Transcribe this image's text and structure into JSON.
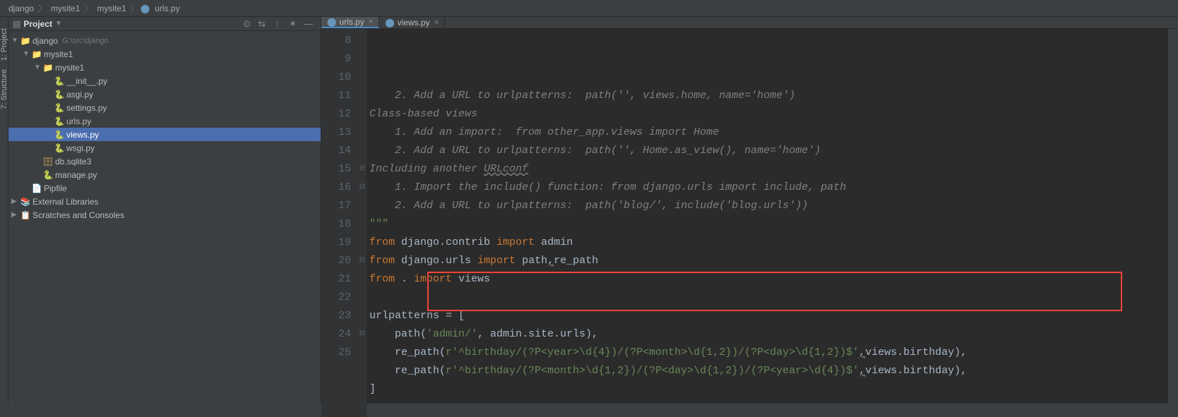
{
  "breadcrumbs": [
    "django",
    "mysite1",
    "mysite1",
    "urls.py"
  ],
  "sidebar": {
    "title": "Project",
    "tree": [
      {
        "d": 0,
        "tw": "open",
        "icon": "dir",
        "label": "django",
        "dim": "G:\\src\\django",
        "sel": ""
      },
      {
        "d": 1,
        "tw": "open",
        "icon": "dir",
        "label": "mysite1",
        "sel": ""
      },
      {
        "d": 2,
        "tw": "open",
        "icon": "dir",
        "label": "mysite1",
        "sel": ""
      },
      {
        "d": 3,
        "tw": "",
        "icon": "py",
        "label": "__init__.py",
        "sel": ""
      },
      {
        "d": 3,
        "tw": "",
        "icon": "py",
        "label": "asgi.py",
        "sel": ""
      },
      {
        "d": 3,
        "tw": "",
        "icon": "py",
        "label": "settings.py",
        "sel": ""
      },
      {
        "d": 3,
        "tw": "",
        "icon": "py",
        "label": "urls.py",
        "sel": ""
      },
      {
        "d": 3,
        "tw": "",
        "icon": "py",
        "label": "views.py",
        "sel": "selected-hl"
      },
      {
        "d": 3,
        "tw": "",
        "icon": "py",
        "label": "wsgi.py",
        "sel": ""
      },
      {
        "d": 2,
        "tw": "",
        "icon": "db",
        "label": "db.sqlite3",
        "sel": ""
      },
      {
        "d": 2,
        "tw": "",
        "icon": "py",
        "label": "manage.py",
        "sel": ""
      },
      {
        "d": 1,
        "tw": "",
        "icon": "txt",
        "label": "Pipfile",
        "sel": ""
      },
      {
        "d": 0,
        "tw": "closed",
        "icon": "lib",
        "label": "External Libraries",
        "sel": ""
      },
      {
        "d": 0,
        "tw": "closed",
        "icon": "scratch",
        "label": "Scratches and Consoles",
        "sel": ""
      }
    ]
  },
  "leftTabs": [
    "1: Project",
    "7: Structure"
  ],
  "tabs": [
    {
      "label": "urls.py",
      "active": true
    },
    {
      "label": "views.py",
      "active": false
    }
  ],
  "lines": [
    {
      "n": 8,
      "segs": [
        {
          "t": "    2. Add a URL to urlpatterns:  path('', views.home, name='home')",
          "c": "c-comment"
        }
      ]
    },
    {
      "n": 9,
      "segs": [
        {
          "t": "Class-based views",
          "c": "c-comment"
        }
      ]
    },
    {
      "n": 10,
      "segs": [
        {
          "t": "    1. Add an import:  from other_app.views import Home",
          "c": "c-comment"
        }
      ]
    },
    {
      "n": 11,
      "segs": [
        {
          "t": "    2. Add a URL to urlpatterns:  path('', Home.as_view(), name='home')",
          "c": "c-comment"
        }
      ]
    },
    {
      "n": 12,
      "segs": [
        {
          "t": "Including another ",
          "c": "c-comment"
        },
        {
          "t": "URLconf",
          "c": "c-comment c-wavy"
        }
      ]
    },
    {
      "n": 13,
      "segs": [
        {
          "t": "    1. Import the include() function: from django.urls import include, path",
          "c": "c-comment"
        }
      ]
    },
    {
      "n": 14,
      "segs": [
        {
          "t": "    2. Add a URL to urlpatterns:  path('blog/', include('blog.urls'))",
          "c": "c-comment"
        }
      ]
    },
    {
      "n": 15,
      "segs": [
        {
          "t": "\"\"\"",
          "c": "c-string"
        }
      ],
      "fold": "⊟"
    },
    {
      "n": 16,
      "segs": [
        {
          "t": "from ",
          "c": "c-keyword"
        },
        {
          "t": "django.contrib ",
          "c": "c-ident"
        },
        {
          "t": "import ",
          "c": "c-keyword"
        },
        {
          "t": "admin",
          "c": "c-ident"
        }
      ],
      "fold": "⊟"
    },
    {
      "n": 17,
      "segs": [
        {
          "t": "from ",
          "c": "c-keyword"
        },
        {
          "t": "django.urls ",
          "c": "c-ident"
        },
        {
          "t": "import ",
          "c": "c-keyword"
        },
        {
          "t": "path",
          "c": "c-ident"
        },
        {
          "t": ",",
          "c": "c-op c-wavy"
        },
        {
          "t": "re_path",
          "c": "c-ident"
        }
      ]
    },
    {
      "n": 18,
      "segs": [
        {
          "t": "from ",
          "c": "c-keyword"
        },
        {
          "t": ". ",
          "c": "c-ident"
        },
        {
          "t": "import ",
          "c": "c-keyword"
        },
        {
          "t": "views",
          "c": "c-ident"
        }
      ]
    },
    {
      "n": 19,
      "segs": [
        {
          "t": "",
          "c": ""
        }
      ]
    },
    {
      "n": 20,
      "segs": [
        {
          "t": "urlpatterns = [",
          "c": "c-ident"
        }
      ],
      "fold": "⊟"
    },
    {
      "n": 21,
      "segs": [
        {
          "t": "    path(",
          "c": "c-ident"
        },
        {
          "t": "'admin/'",
          "c": "c-string"
        },
        {
          "t": ", admin.site.urls),",
          "c": "c-ident"
        }
      ]
    },
    {
      "n": 22,
      "segs": [
        {
          "t": "    re_path(",
          "c": "c-ident"
        },
        {
          "t": "r'^birthday/(?P<year>\\d{4})/(?P<month>\\d{1,2})/(?P<day>\\d{1,2})$'",
          "c": "c-string"
        },
        {
          "t": ",",
          "c": "c-op c-wavy"
        },
        {
          "t": "views.birthday),",
          "c": "c-ident"
        }
      ]
    },
    {
      "n": 23,
      "segs": [
        {
          "t": "    re_path(",
          "c": "c-ident"
        },
        {
          "t": "r'^birthday/(?P<month>\\d{1,2})/(?P<day>\\d{1,2})/(?P<year>\\d{4})$'",
          "c": "c-string"
        },
        {
          "t": ",",
          "c": "c-op c-wavy"
        },
        {
          "t": "views.birthday),",
          "c": "c-ident"
        }
      ]
    },
    {
      "n": 24,
      "segs": [
        {
          "t": "]",
          "c": "c-ident"
        }
      ],
      "fold": "⊟"
    },
    {
      "n": 25,
      "segs": [
        {
          "t": "",
          "c": ""
        }
      ]
    }
  ]
}
